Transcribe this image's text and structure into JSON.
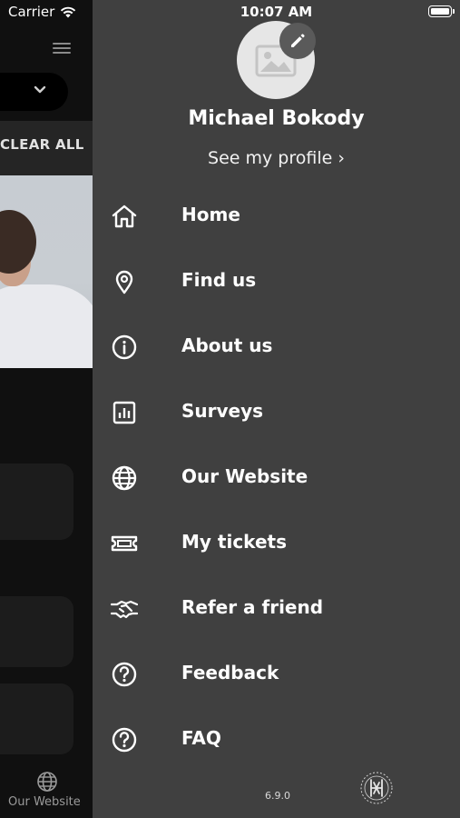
{
  "status_bar": {
    "carrier": "Carrier",
    "time": "10:07 AM"
  },
  "background_app": {
    "clear_all_label": "CLEAR ALL",
    "bottom_tab_label": "Our Website"
  },
  "drawer": {
    "user_name": "Michael Bokody",
    "profile_link": "See my profile ›",
    "menu": [
      {
        "label": "Home",
        "icon": "home-icon"
      },
      {
        "label": "Find us",
        "icon": "location-pin-icon"
      },
      {
        "label": "About us",
        "icon": "info-icon"
      },
      {
        "label": "Surveys",
        "icon": "bar-chart-icon"
      },
      {
        "label": "Our Website",
        "icon": "globe-icon"
      },
      {
        "label": "My tickets",
        "icon": "ticket-icon"
      },
      {
        "label": "Refer a friend",
        "icon": "handshake-icon"
      },
      {
        "label": "Feedback",
        "icon": "help-circle-icon"
      },
      {
        "label": "FAQ",
        "icon": "help-circle-icon"
      }
    ],
    "version": "6.9.0"
  },
  "colors": {
    "drawer_bg": "#404040",
    "app_bg": "#101010",
    "text": "#ffffff"
  }
}
